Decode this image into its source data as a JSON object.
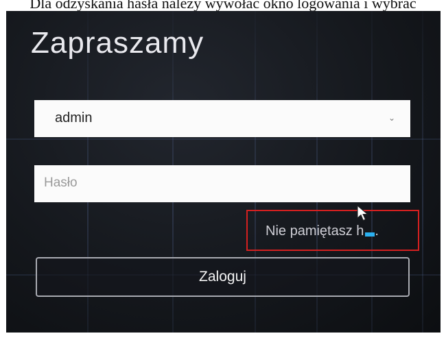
{
  "caption": "Dla odzyskania hasła należy wywołać okno logowania i wybrać",
  "login": {
    "title": "Zapraszamy",
    "username_value": "admin",
    "password_placeholder": "Hasło",
    "forgot_label": "Nie pamiętasz h",
    "forgot_tail": ".",
    "submit_label": "Zaloguj"
  },
  "colors": {
    "highlight_box": "#d52020",
    "caret_accent": "#2ab0f0",
    "background": "#15181d"
  },
  "icons": {
    "dropdown": "chevron-down-icon",
    "pointer": "mouse-pointer-icon"
  }
}
